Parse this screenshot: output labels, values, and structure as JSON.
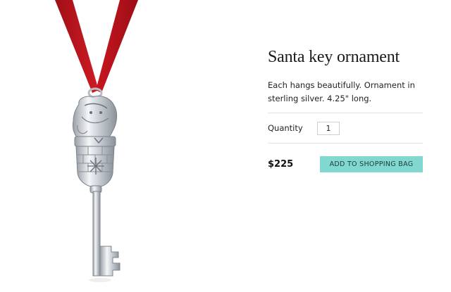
{
  "product": {
    "title": "Santa key ornament",
    "description": "Each hangs beautifully. Ornament in sterling silver. 4.25\" long.",
    "quantity_label": "Quantity",
    "quantity_value": "1",
    "price": "$225",
    "add_button_label": "ADD TO SHOPPING BAG"
  },
  "image": {
    "subject": "silver-santa-key-ornament-on-red-ribbon",
    "ribbon_color": "#b8141c",
    "silver_color": "#d9dde2"
  },
  "colors": {
    "accent": "#81d8d0",
    "divider": "#e3e3e3",
    "text": "#222222"
  }
}
